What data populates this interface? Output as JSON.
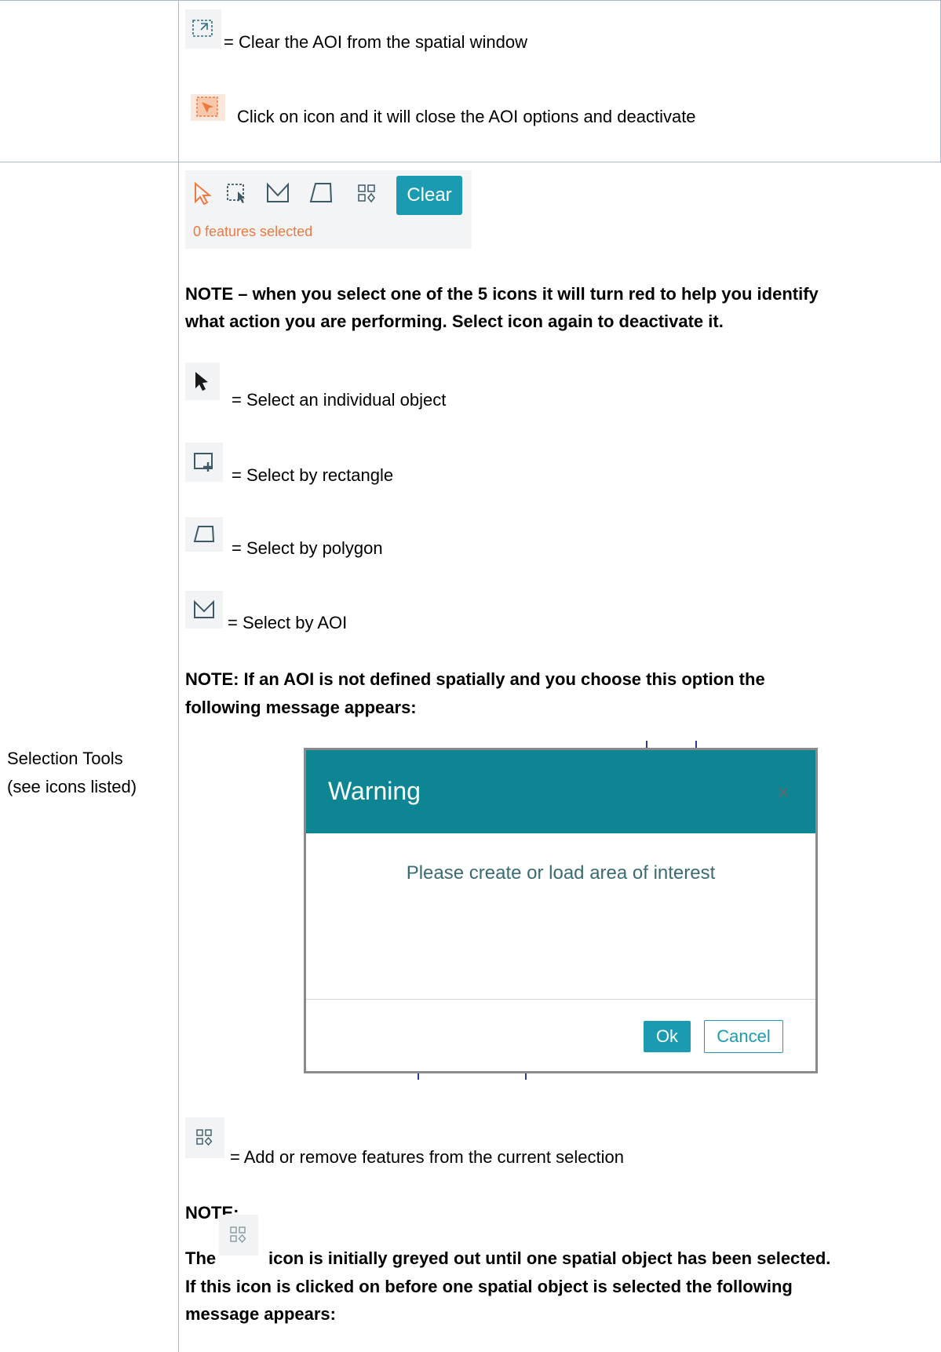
{
  "row1": {
    "clear_aoi_text": "= Clear the AOI from the spatial window",
    "close_aoi_text": "Click on icon and it will close the AOI options and deactivate"
  },
  "row2": {
    "left_label_line1": "Selection Tools",
    "left_label_line2": "(see icons listed)",
    "toolbar": {
      "clear_label": "Clear",
      "features_selected": "0 features selected"
    },
    "note1_line1": "NOTE – when you select one of the 5 icons it will turn red to help you identify",
    "note1_line2": "what action you are performing.  Select icon again to deactivate it.",
    "select_individual": "= Select an individual object",
    "select_rectangle": "= Select by rectangle",
    "select_polygon": "= Select by polygon",
    "select_aoi": "= Select by AOI",
    "note2_line1": "NOTE: If an AOI is not defined spatially and you choose this option the",
    "note2_line2": "following message appears:",
    "dialog": {
      "title": "Warning",
      "close_glyph": "×",
      "message": "Please create or load area of interest",
      "ok_label": "Ok",
      "cancel_label": "Cancel"
    },
    "add_remove_text": "= Add or remove features from the current selection",
    "note3_label": "NOTE:",
    "note3_the": "The",
    "note3_line1": "icon is initially greyed out until one spatial object has been selected.",
    "note3_line2": "If this icon is clicked on before one spatial object is selected the following",
    "note3_line3": "message appears:"
  },
  "colors": {
    "accent": "#1b9bb1",
    "dialog_header": "#0e8593",
    "active_tool": "#f07841"
  }
}
